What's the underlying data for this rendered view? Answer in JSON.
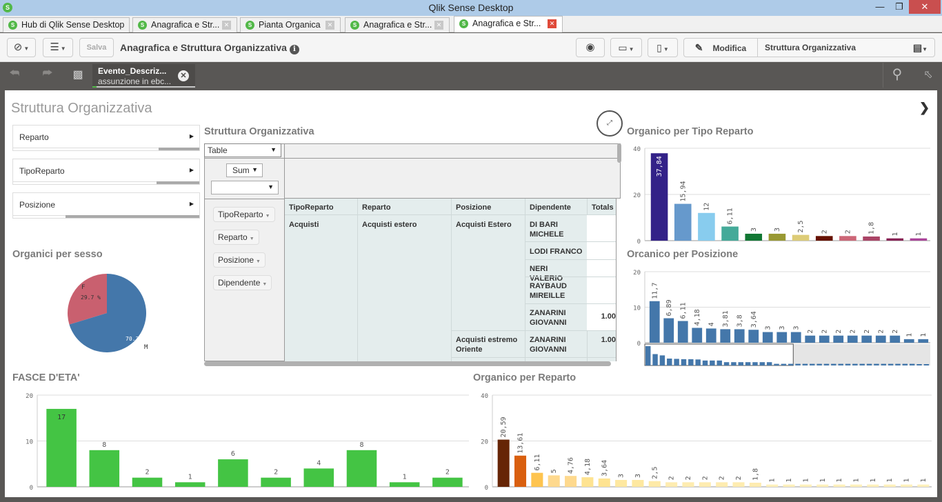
{
  "window": {
    "title": "Qlik Sense Desktop",
    "min_icon": "minimize-icon",
    "max_icon": "restore-icon",
    "close_icon": "close-icon"
  },
  "tabs": [
    {
      "label": "Hub di Qlik Sense Desktop",
      "closable": false,
      "active": false
    },
    {
      "label": "Anagrafica e Str...",
      "closable": true,
      "active": false
    },
    {
      "label": "Pianta Organica",
      "closable": true,
      "active": false
    },
    {
      "label": "Anagrafica e Str...",
      "closable": true,
      "active": false
    },
    {
      "label": "Anagrafica e Str...",
      "closable": true,
      "active": true
    }
  ],
  "toolbar": {
    "nav_icon": "compass-icon",
    "menu_icon": "list-icon",
    "save_label": "Salva",
    "app_title": "Anagrafica e Struttura Organizzativa",
    "info_icon": "info-icon",
    "snapshot_icon": "camera-icon",
    "story_icon": "presentation-icon",
    "bookmark_icon": "bookmark-icon",
    "edit_label": "Modifica",
    "sheet_name": "Struttura Organizzativa",
    "sheets_icon": "sheets-icon"
  },
  "selections": {
    "back_icon": "step-back-icon",
    "forward_icon": "step-forward-icon",
    "clear_icon": "clear-selections-icon",
    "chip": {
      "field": "Evento_Descriz...",
      "value": "assunzione in ebc..."
    },
    "search_icon": "search-icon",
    "selection_tool_icon": "selection-tool-icon"
  },
  "sheet": {
    "title": "Struttura Organizzativa",
    "next_icon": "chevron-right-icon",
    "filters": [
      {
        "label": "Reparto",
        "selected_fraction": 0.22
      },
      {
        "label": "TipoReparto",
        "selected_fraction": 0.23
      },
      {
        "label": "Posizione",
        "selected_fraction": 0.72
      }
    ]
  },
  "pivot": {
    "title": "Struttura Organizzativa",
    "view_select": "Table",
    "agg_select": "Sum",
    "measure_select": "",
    "dimension_chips": [
      "TipoReparto",
      "Reparto",
      "Posizione",
      "Dipendente"
    ],
    "columns": [
      "TipoReparto",
      "Reparto",
      "Posizione",
      "Dipendente",
      "Totals"
    ],
    "rows": {
      "tipo": "Acquisti",
      "reparto": "Acquisti estero",
      "posizioni": [
        {
          "name": "Acquisti Estero",
          "dipendenti": [
            {
              "name": "DI BARI MICHELE",
              "total": ""
            },
            {
              "name": "LODI FRANCO",
              "total": ""
            },
            {
              "name": "NERI VALERIO",
              "total": ""
            },
            {
              "name": "RAYBAUD MIREILLE",
              "total": ""
            },
            {
              "name": "ZANARINI GIOVANNI",
              "total": "1.00"
            }
          ]
        },
        {
          "name": "Acquisti estremo Oriente",
          "dipendenti": [
            {
              "name": "ZANARINI GIOVANNI",
              "total": "1.00"
            }
          ]
        }
      ]
    }
  },
  "chart_data": [
    {
      "id": "sesso",
      "type": "pie",
      "title": "Organici per sesso",
      "categories": [
        "F",
        "M"
      ],
      "values": [
        29.7,
        70.3
      ],
      "labels": [
        "29.7 %",
        "70.3 %"
      ],
      "colors": [
        "#c9606f",
        "#4477aa"
      ]
    },
    {
      "id": "tipo",
      "type": "bar",
      "title": "Organico per Tipo Reparto",
      "values": [
        37.84,
        15.94,
        12,
        6.11,
        3,
        3,
        2.5,
        2,
        2,
        1.8,
        1,
        1
      ],
      "labels": [
        "37,84",
        "15,94",
        "12",
        "6,11",
        "3",
        "3",
        "2,5",
        "2",
        "2",
        "1,8",
        "1",
        "1"
      ],
      "colors": [
        "#332288",
        "#6699cc",
        "#88ccee",
        "#44aa99",
        "#117733",
        "#999933",
        "#ddcc77",
        "#661100",
        "#cc6677",
        "#aa4466",
        "#882255",
        "#aa4499"
      ],
      "ylim": [
        0,
        40
      ],
      "yticks": [
        "40",
        "20",
        "0"
      ]
    },
    {
      "id": "posizione",
      "type": "bar",
      "title": "Orcanico per Posizione",
      "values": [
        11.7,
        6.89,
        6.11,
        4.18,
        4,
        3.81,
        3.8,
        3.64,
        3,
        3,
        3,
        2,
        2,
        2,
        2,
        2,
        2,
        2,
        1,
        1
      ],
      "labels": [
        "11,7",
        "6,89",
        "6,11",
        "4,18",
        "4",
        "3,81",
        "3,8",
        "3,64",
        "3",
        "3",
        "3",
        "2",
        "2",
        "2",
        "2",
        "2",
        "2",
        "2",
        "1",
        "1"
      ],
      "color": "#4477aa",
      "ylim": [
        0,
        20
      ],
      "yticks": [
        "20",
        "10",
        "0"
      ],
      "minimap_values": [
        11.7,
        6.89,
        6.11,
        4.18,
        4,
        3.81,
        3.8,
        3.64,
        3,
        3,
        3,
        2,
        2,
        2,
        2,
        2,
        2,
        2,
        1,
        1,
        1,
        1,
        1,
        1,
        1,
        1,
        1,
        1,
        1,
        1,
        1,
        1,
        1,
        1,
        1,
        1,
        1,
        1,
        0.8,
        0.6
      ],
      "minimap_visible_fraction": 0.52
    },
    {
      "id": "eta",
      "type": "bar",
      "title": "FASCE D'ETA'",
      "values": [
        17,
        8,
        2,
        1,
        6,
        2,
        4,
        8,
        1,
        2
      ],
      "labels": [
        "17",
        "8",
        "2",
        "1",
        "6",
        "2",
        "4",
        "8",
        "1",
        "2"
      ],
      "color": "#44c444",
      "ylim": [
        0,
        20
      ],
      "yticks": [
        "20",
        "10",
        "0"
      ]
    },
    {
      "id": "reparto",
      "type": "bar",
      "title": "Organico per Reparto",
      "values": [
        20.59,
        13.61,
        6.11,
        5,
        4.76,
        4.18,
        3.64,
        3,
        3,
        2.5,
        2,
        2,
        2,
        2,
        2,
        1.8,
        1,
        1,
        1,
        1,
        1,
        1,
        1,
        1,
        1,
        1
      ],
      "labels": [
        "20,59",
        "13,61",
        "6,11",
        "5",
        "4,76",
        "4,18",
        "3,64",
        "3",
        "3",
        "2,5",
        "2",
        "2",
        "2",
        "2",
        "2",
        "1,8",
        "1",
        "1",
        "1",
        "1",
        "1",
        "1",
        "1",
        "1",
        "1",
        "1"
      ],
      "colors": [
        "#662506",
        "#d95f0e",
        "#fec44f",
        "#fed98e",
        "#fed98e",
        "#fee391",
        "#fee391",
        "#fee8a0",
        "#fee8a0",
        "#feeaa8",
        "#feecb0",
        "#feecb0",
        "#feecb0",
        "#feecb0",
        "#feecb0",
        "#feecb0",
        "#fff0bb",
        "#fff0bb",
        "#fff0bb",
        "#fff0bb",
        "#fff0bb",
        "#fff0bb",
        "#fff0bb",
        "#fff0bb",
        "#fff0bb",
        "#fff0bb"
      ],
      "ylim": [
        0,
        40
      ],
      "yticks": [
        "40",
        "20",
        "0"
      ]
    }
  ]
}
